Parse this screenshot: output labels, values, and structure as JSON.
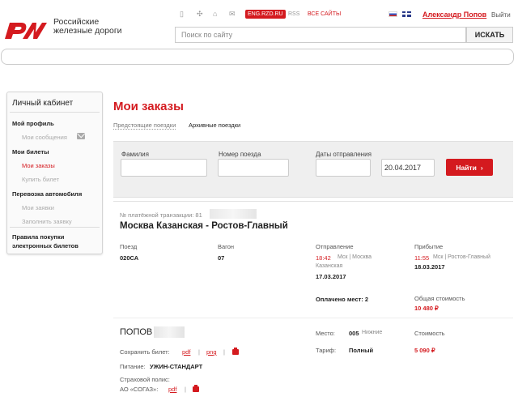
{
  "header": {
    "logo_line1": "Российские",
    "logo_line2": "железные дороги",
    "eng_badge": "ENG.RZD.RU",
    "rss": "RSS",
    "all_sites": "ВСЕ САЙТЫ",
    "user_name": "Александр Попов",
    "exit": "Выйти",
    "search_placeholder": "Поиск по сайту",
    "search_button": "ИСКАТЬ"
  },
  "sidebar": {
    "title": "Личный кабинет",
    "items": [
      {
        "label": "Мой профиль"
      },
      {
        "label": "Мои сообщения"
      },
      {
        "label": "Мои билеты"
      },
      {
        "label": "Мои заказы"
      },
      {
        "label": "Купить билет"
      },
      {
        "label": "Перевозка автомобиля"
      },
      {
        "label": "Мои заявки"
      },
      {
        "label": "Заполнить заявку"
      },
      {
        "label_line1": "Правила покупки",
        "label_line2": "электронных билетов"
      }
    ]
  },
  "main": {
    "title": "Мои заказы",
    "tabs": [
      {
        "label": "Предстоящие поездки"
      },
      {
        "label": "Архивные поездки"
      }
    ],
    "filters": {
      "surname_label": "Фамилия",
      "surname_value": "",
      "train_label": "Номер поезда",
      "train_value": "",
      "dates_label": "Даты отправления",
      "date_from": "",
      "date_to": "20.04.2017",
      "find_button": "Найти",
      "find_arrow": "›"
    },
    "order": {
      "transaction_label": "№ платёжной транзакции: 81",
      "route": "Москва Казанская - Ростов-Главный",
      "train_label": "Поезд",
      "train_value": "020СА",
      "car_label": "Вагон",
      "car_value": "07",
      "departure_label": "Отправление",
      "departure_time": "18:42",
      "departure_tz": "Мск | Москва",
      "departure_station": "Казанская",
      "departure_date": "17.03.2017",
      "arrival_label": "Прибытие",
      "arrival_time": "11:55",
      "arrival_tz": "Мск | Ростов-Главный",
      "arrival_date": "18.03.2017",
      "paid_seats": "Оплачено мест: 2",
      "total_cost_label": "Общая стоимость",
      "total_cost_value": "10 480 ₽",
      "passenger": {
        "surname": "ПОПОВ",
        "save_ticket_label": "Сохранить билет:",
        "pdf": "pdf",
        "png": "png",
        "pipe": "|",
        "meal_label": "Питание:",
        "meal_value": "УЖИН-СТАНДАРТ",
        "insurance_label": "Страховой полис:",
        "insurance_company": "АО «СОГАЗ»:",
        "seat_label": "Место:",
        "seat_value": "005",
        "seat_type": "Нижние",
        "tariff_label": "Тариф:",
        "tariff_value": "Полный",
        "cost_label": "Стоимость",
        "cost_value": "5 090 ₽"
      }
    }
  },
  "colors": {
    "brand": "#d41a1f"
  }
}
